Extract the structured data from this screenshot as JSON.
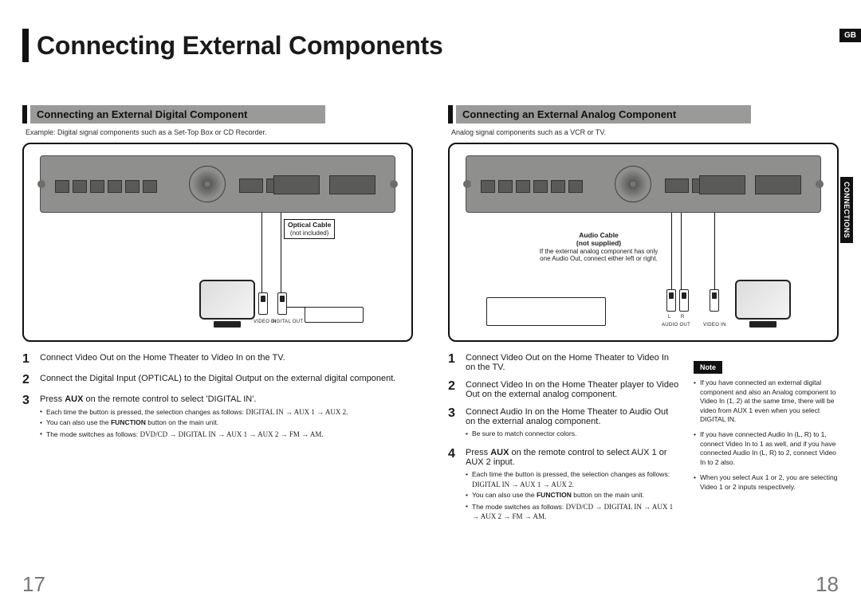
{
  "lang_flag": "GB",
  "side_tab": "CONNECTIONS",
  "title": "Connecting External Components",
  "pages": {
    "left": "17",
    "right": "18"
  },
  "left": {
    "heading": "Connecting an External Digital Component",
    "sub": "Example: Digital signal components such as a Set-Top Box or CD Recorder.",
    "callout": {
      "title": "Optical Cable",
      "sub": "(not included)"
    },
    "plug_labels": {
      "left": "VIDEO IN",
      "right": "DIGITAL OUT"
    },
    "steps": [
      {
        "n": "1",
        "text": "Connect Video Out on the Home Theater to Video In on the TV."
      },
      {
        "n": "2",
        "text": "Connect the Digital Input (OPTICAL) to the Digital Output on the external digital component."
      },
      {
        "n": "3",
        "text_pre": "Press ",
        "text_strong": "AUX",
        "text_post": " on the remote control to select 'DIGITAL IN'.",
        "bullets": [
          {
            "pre": "Each time the button is pressed, the selection changes as follows: ",
            "seq": "DIGITAL IN → AUX 1 → AUX 2."
          },
          {
            "pre": "You can also use the ",
            "strong": "FUNCTION",
            "post": " button on the main unit."
          },
          {
            "pre": "The mode switches as follows: ",
            "seq": "DVD/CD → DIGITAL IN → AUX 1 → AUX 2 → FM → AM."
          }
        ]
      }
    ]
  },
  "right": {
    "heading": "Connecting an External Analog Component",
    "sub": "Analog signal components such as a VCR or TV.",
    "callout": {
      "title": "Audio Cable",
      "sub1": "(not supplied)",
      "body": "If the external analog component has only one Audio Out, connect either left or right."
    },
    "plug_labels": {
      "left_l": "L",
      "left_r": "R",
      "audio": "AUDIO OUT",
      "video": "VIDEO IN"
    },
    "steps": [
      {
        "n": "1",
        "text": "Connect Video Out on the Home Theater to Video In on the TV."
      },
      {
        "n": "2",
        "text": "Connect Video In on the Home Theater player to Video Out on the external analog component."
      },
      {
        "n": "3",
        "text": "Connect Audio In on the Home Theater to Audio Out on the external analog component.",
        "bullets": [
          {
            "pre": "Be sure to match connector colors."
          }
        ]
      },
      {
        "n": "4",
        "text_pre": "Press ",
        "text_strong": "AUX",
        "text_post": " on the remote control to select AUX 1 or AUX 2 input.",
        "bullets": [
          {
            "pre": "Each time the button is pressed, the selection changes as follows: ",
            "seq": "DIGITAL IN → AUX 1 → AUX 2."
          },
          {
            "pre": "You can also use the ",
            "strong": "FUNCTION",
            "post": " button on the main unit."
          },
          {
            "pre": "The mode switches as follows: ",
            "seq": "DVD/CD → DIGITAL IN → AUX 1 → AUX 2 → FM → AM."
          }
        ]
      }
    ],
    "note": {
      "label": "Note",
      "items": [
        "If you have connected an external digital component and also an Analog component to Video In (1, 2) at the same time, there will be video from AUX 1 even when you select DIGITAL IN.",
        "If you have connected Audio In (L, R) to 1, connect Video In to 1 as well, and if you have connected Audio In (L, R) to 2, connect Video In to 2 also.",
        "When you select Aux 1 or 2, you are selecting Video 1 or 2 inputs respectively."
      ]
    }
  }
}
